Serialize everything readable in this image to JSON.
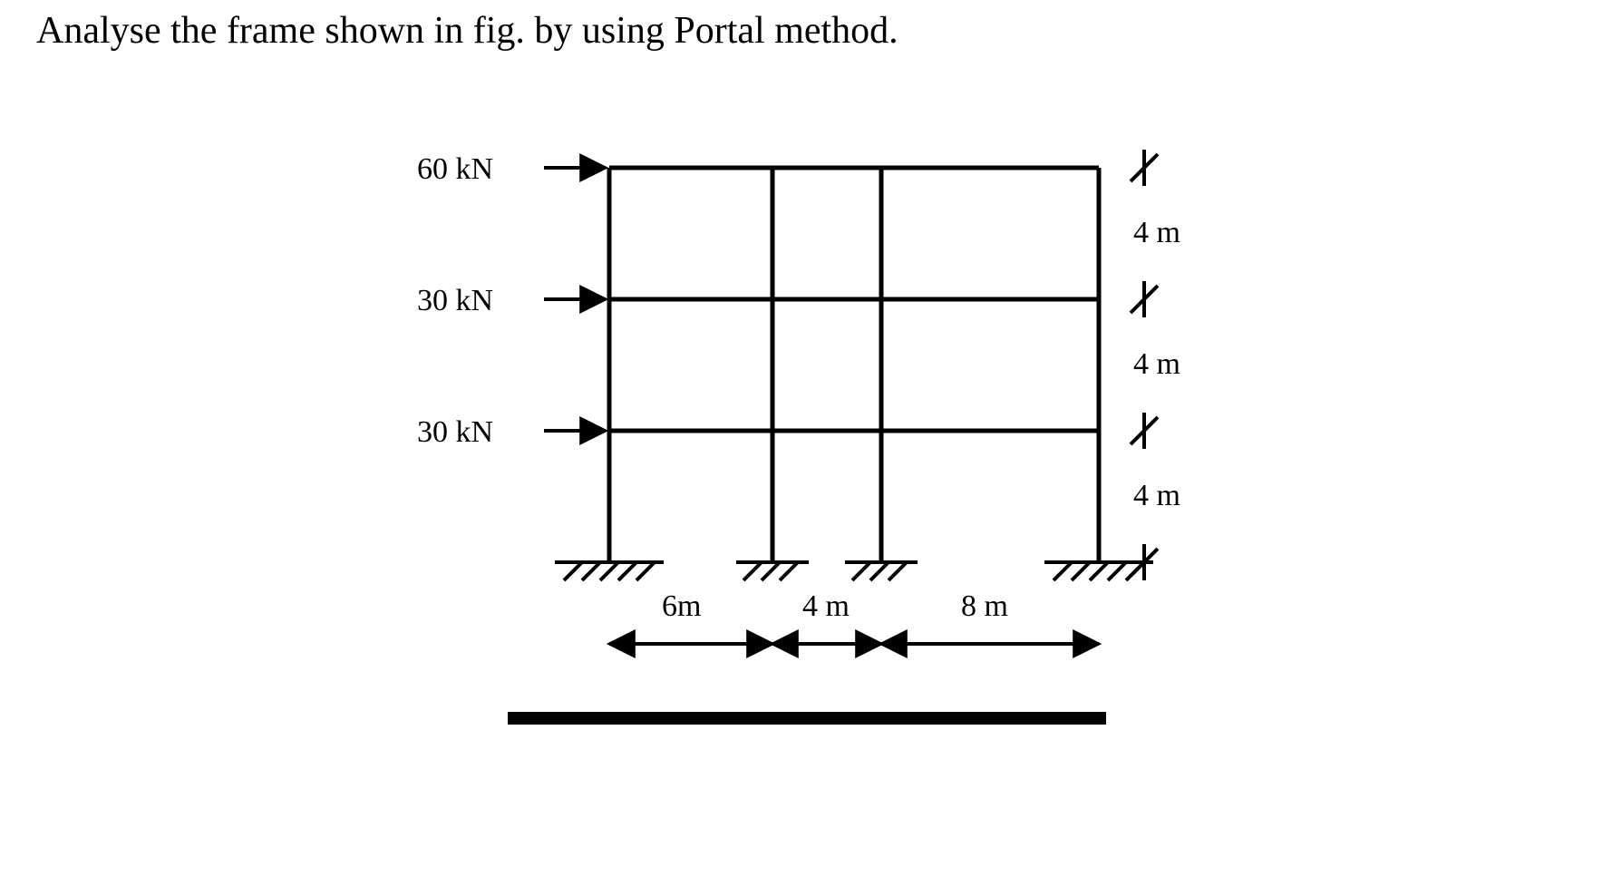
{
  "title": "Analyse the frame shown in fig.   by using Portal method.",
  "forces": [
    {
      "value": "60 kN",
      "y_level": "top"
    },
    {
      "value": "30 kN",
      "y_level": "mid_upper"
    },
    {
      "value": "30 kN",
      "y_level": "mid_lower"
    }
  ],
  "bay_widths": [
    {
      "label": "6m",
      "span_m": 6
    },
    {
      "label": "4 m",
      "span_m": 4
    },
    {
      "label": "8 m",
      "span_m": 8
    }
  ],
  "storey_heights": [
    {
      "label": "4 m",
      "span_m": 4
    },
    {
      "label": "4 m",
      "span_m": 4
    },
    {
      "label": "4 m",
      "span_m": 4
    }
  ],
  "chart_data": {
    "type": "diagram",
    "structure": "portal-frame",
    "columns_x_m": [
      0,
      6,
      10,
      18
    ],
    "beam_levels_y_m": [
      4,
      8,
      12
    ],
    "storey_height_m": 4,
    "lateral_loads_kN": [
      {
        "level_m": 12,
        "force_kN": 60
      },
      {
        "level_m": 8,
        "force_kN": 30
      },
      {
        "level_m": 4,
        "force_kN": 30
      }
    ],
    "supports": "fixed",
    "bays_m": [
      6,
      4,
      8
    ],
    "storeys_m": [
      4,
      4,
      4
    ]
  }
}
